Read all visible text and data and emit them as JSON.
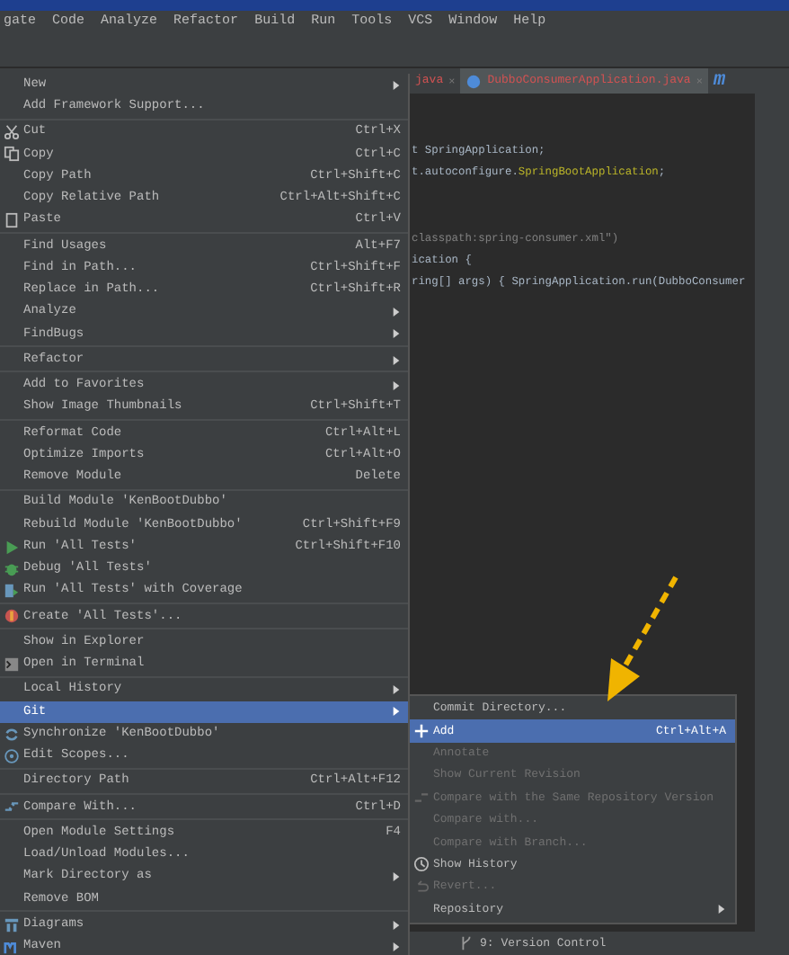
{
  "menu_bar": [
    "gate",
    "Code",
    "Analyze",
    "Refactor",
    "Build",
    "Run",
    "Tools",
    "VCS",
    "Window",
    "Help"
  ],
  "editor": {
    "tabs": [
      {
        "label": "java",
        "close": "×",
        "selected": false
      },
      {
        "label": "DubboConsumerApplication.java",
        "close": "×",
        "selected": true
      },
      {
        "label": "m",
        "selected": false
      }
    ],
    "blocks": [
      [
        [
          {
            "text": "t SpringApplication;",
            "kind": "plain"
          }
        ],
        [
          {
            "text": "t.autoconfigure.",
            "kind": "plain"
          },
          {
            "text": "SpringBootApplication",
            "kind": "annotation"
          },
          {
            "text": ";",
            "kind": "plain"
          }
        ]
      ],
      [
        [
          {
            "text": "classpath:spring-consumer.xml\")",
            "kind": "string"
          }
        ],
        [
          {
            "text": "ication {",
            "kind": "plain"
          }
        ],
        [
          {
            "text": "ring[] args) { SpringApplication.run(DubboConsumer",
            "kind": "plain"
          }
        ]
      ]
    ]
  },
  "context_menu": {
    "items": [
      {
        "kind": "item",
        "label": "New",
        "has_submenu": true,
        "selected": false
      },
      {
        "kind": "item",
        "label": "Add Framework Support...",
        "has_submenu": false,
        "selected": false
      },
      {
        "kind": "separator"
      },
      {
        "kind": "item",
        "label": "Cut",
        "shortcut": "Ctrl+X",
        "has_submenu": false,
        "selected": false
      },
      {
        "kind": "item",
        "label": "Copy",
        "shortcut": "Ctrl+C",
        "has_submenu": false,
        "selected": false
      },
      {
        "kind": "item",
        "label": "Copy Path",
        "shortcut": "Ctrl+Shift+C",
        "has_submenu": false,
        "selected": false
      },
      {
        "kind": "item",
        "label": "Copy Relative Path",
        "shortcut": "Ctrl+Alt+Shift+C",
        "has_submenu": false,
        "selected": false
      },
      {
        "kind": "item",
        "label": "Paste",
        "shortcut": "Ctrl+V",
        "has_submenu": false,
        "selected": false
      },
      {
        "kind": "separator"
      },
      {
        "kind": "item",
        "label": "Find Usages",
        "shortcut": "Alt+F7",
        "has_submenu": false,
        "selected": false
      },
      {
        "kind": "item",
        "label": "Find in Path...",
        "shortcut": "Ctrl+Shift+F",
        "has_submenu": false,
        "selected": false
      },
      {
        "kind": "item",
        "label": "Replace in Path...",
        "shortcut": "Ctrl+Shift+R",
        "has_submenu": false,
        "selected": false
      },
      {
        "kind": "item",
        "label": "Analyze",
        "has_submenu": true,
        "selected": false
      },
      {
        "kind": "item",
        "label": "FindBugs",
        "has_submenu": true,
        "selected": false
      },
      {
        "kind": "separator"
      },
      {
        "kind": "item",
        "label": "Refactor",
        "has_submenu": true,
        "selected": false
      },
      {
        "kind": "separator"
      },
      {
        "kind": "item",
        "label": "Add to Favorites",
        "has_submenu": true,
        "selected": false
      },
      {
        "kind": "item",
        "label": "Show Image Thumbnails",
        "shortcut": "Ctrl+Shift+T",
        "has_submenu": false,
        "selected": false
      },
      {
        "kind": "separator"
      },
      {
        "kind": "item",
        "label": "Reformat Code",
        "shortcut": "Ctrl+Alt+L",
        "has_submenu": false,
        "selected": false
      },
      {
        "kind": "item",
        "label": "Optimize Imports",
        "shortcut": "Ctrl+Alt+O",
        "has_submenu": false,
        "selected": false
      },
      {
        "kind": "item",
        "label": "Remove Module",
        "shortcut": "Delete",
        "has_submenu": false,
        "selected": false
      },
      {
        "kind": "separator"
      },
      {
        "kind": "item",
        "label": "Build Module 'KenBootDubbo'",
        "has_submenu": false,
        "selected": false
      },
      {
        "kind": "item",
        "label": "Rebuild Module 'KenBootDubbo'",
        "shortcut": "Ctrl+Shift+F9",
        "has_submenu": false,
        "selected": false
      },
      {
        "kind": "item",
        "label": "Run 'All Tests'",
        "shortcut": "Ctrl+Shift+F10",
        "has_submenu": false,
        "selected": false
      },
      {
        "kind": "item",
        "label": "Debug 'All Tests'",
        "has_submenu": false,
        "selected": false
      },
      {
        "kind": "item",
        "label": "Run 'All Tests' with Coverage",
        "has_submenu": false,
        "selected": false
      },
      {
        "kind": "separator"
      },
      {
        "kind": "item",
        "label": "Create 'All Tests'...",
        "has_submenu": false,
        "selected": false
      },
      {
        "kind": "separator"
      },
      {
        "kind": "item",
        "label": "Show in Explorer",
        "has_submenu": false,
        "selected": false
      },
      {
        "kind": "item",
        "label": "Open in Terminal",
        "has_submenu": false,
        "selected": false
      },
      {
        "kind": "separator"
      },
      {
        "kind": "item",
        "label": "Local History",
        "has_submenu": true,
        "selected": false
      },
      {
        "kind": "item",
        "label": "Git",
        "has_submenu": true,
        "selected": true
      },
      {
        "kind": "item",
        "label": "Synchronize 'KenBootDubbo'",
        "has_submenu": false,
        "selected": false
      },
      {
        "kind": "item",
        "label": "Edit Scopes...",
        "has_submenu": false,
        "selected": false
      },
      {
        "kind": "separator"
      },
      {
        "kind": "item",
        "label": "Directory Path",
        "shortcut": "Ctrl+Alt+F12",
        "has_submenu": false,
        "selected": false
      },
      {
        "kind": "separator"
      },
      {
        "kind": "item",
        "label": "Compare With...",
        "shortcut": "Ctrl+D",
        "has_submenu": false,
        "selected": false
      },
      {
        "kind": "separator"
      },
      {
        "kind": "item",
        "label": "Open Module Settings",
        "shortcut": "F4",
        "has_submenu": false,
        "selected": false
      },
      {
        "kind": "item",
        "label": "Load/Unload Modules...",
        "has_submenu": false,
        "selected": false
      },
      {
        "kind": "item",
        "label": "Mark Directory as",
        "has_submenu": true,
        "selected": false
      },
      {
        "kind": "item",
        "label": "Remove BOM",
        "has_submenu": false,
        "selected": false
      },
      {
        "kind": "separator"
      },
      {
        "kind": "item",
        "label": "Diagrams",
        "has_submenu": true,
        "selected": false
      },
      {
        "kind": "item",
        "label": "Maven",
        "has_submenu": true,
        "selected": false
      }
    ]
  },
  "git_submenu": {
    "items": [
      {
        "label": "Commit Directory...",
        "disabled": false,
        "selected": false,
        "has_submenu": false
      },
      {
        "label": "Add",
        "shortcut": "Ctrl+Alt+A",
        "disabled": false,
        "selected": true,
        "has_submenu": false
      },
      {
        "label": "Annotate",
        "disabled": true,
        "selected": false,
        "has_submenu": false
      },
      {
        "label": "Show Current Revision",
        "disabled": true,
        "selected": false,
        "has_submenu": false
      },
      {
        "label": "Compare with the Same Repository Version",
        "disabled": true,
        "selected": false,
        "has_submenu": false
      },
      {
        "label": "Compare with...",
        "disabled": true,
        "selected": false,
        "has_submenu": false
      },
      {
        "label": "Compare with Branch...",
        "disabled": true,
        "selected": false,
        "has_submenu": false
      },
      {
        "label": "Show History",
        "disabled": false,
        "selected": false,
        "has_submenu": false
      },
      {
        "label": "Revert...",
        "disabled": true,
        "selected": false,
        "has_submenu": false
      },
      {
        "label": "Repository",
        "disabled": false,
        "selected": false,
        "has_submenu": true
      }
    ]
  },
  "bottom_tab": {
    "label": "9: Version Control"
  }
}
